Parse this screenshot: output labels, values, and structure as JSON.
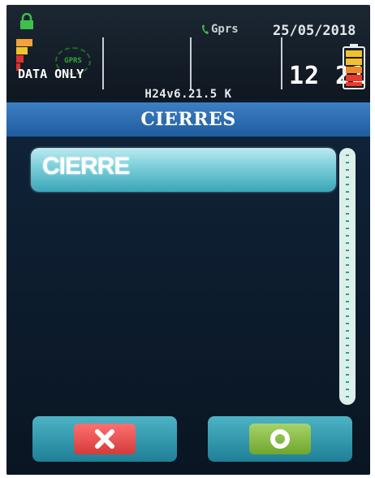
{
  "status": {
    "gprs_badge": "GPRS",
    "data_mode": "DATA ONLY",
    "network": "Gprs",
    "date": "25/05/2018",
    "time": "12 21",
    "version": "H24v6.21.5 K"
  },
  "screen": {
    "title": "CIERRES",
    "items": [
      {
        "label": "CIERRE"
      }
    ]
  },
  "icons": {
    "lock": "lock-icon",
    "signal": "signal-strength-icon",
    "phone": "phone-icon",
    "battery": "battery-icon",
    "cancel": "close-icon",
    "confirm": "circle-icon"
  },
  "colors": {
    "title_bar": "#2d6eb2",
    "item_accent": "#7fd0dc",
    "cancel": "#e24a4a",
    "confirm": "#86bb40"
  }
}
